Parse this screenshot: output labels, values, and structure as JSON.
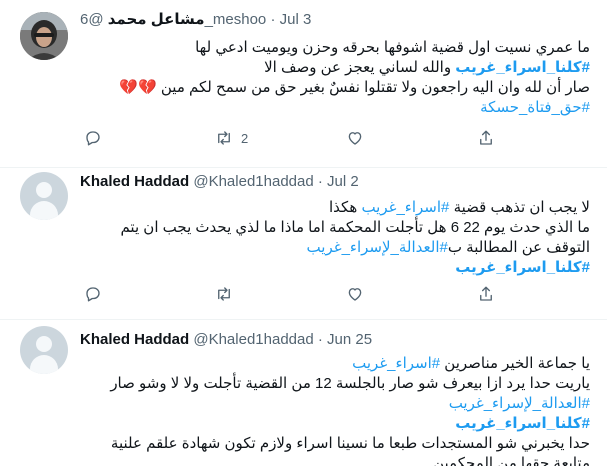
{
  "tweets": [
    {
      "name": "مشاعل محمد",
      "handle": "@6_meshoo",
      "separator": "·",
      "date": "Jul 3",
      "lines": [
        "ما عمري نسيت اول قضية اشوفها بحرقه وحزن ويوميت ادعي لها",
        "والله لساني يعجز عن وصف الا",
        "صار أن لله وان اليه راجعون ولا تقتلوا نفسٌ بغير حق من سمح لكم مين"
      ],
      "hashtag_main": "#كلنا_اسراء_غريب",
      "hashtag_small": "#حق_فتاة_حسكة",
      "hearts": "💔💔",
      "retweets": "2"
    },
    {
      "name": "Khaled Haddad",
      "handle": "@Khaled1haddad",
      "separator": "·",
      "date": "Jul 2",
      "line1_text": "لا يجب ان تذهب قضية",
      "line1_tag": "#اسراء_غريب",
      "line1_end": "هكذا",
      "line2": "ما الذي حدث يوم 22 6 هل تأجلت المحكمة اما ماذا ما لذي يحدث يجب ان يتم",
      "line3_text": "التوقف عن المطالبة ب",
      "line3_tag": "#العدالة_لإسراء_غريب",
      "hashtag_main": "#كلنا_اسراء_غريب"
    },
    {
      "name": "Khaled Haddad",
      "handle": "@Khaled1haddad",
      "separator": "·",
      "date": "Jun 25",
      "line1_text": "يا جماعة الخير مناصرين",
      "line1_tag": "#اسراء_غريب",
      "line2": "ياريت حدا يرد ازا بيعرف شو صار بالجلسة 12 من القضية تأجلت ولا لا وشو صار",
      "line3_tag": "#العدالة_لإسراء_غريب",
      "hashtag_main": "#كلنا_اسراء_غريب",
      "line5": "حدا يخبرني شو المستجدات طبعا ما نسينا اسراء ولازم تكون شهادة علقم علنية",
      "line6": "متابعة حقها من المحكمين"
    }
  ],
  "icons": {
    "reply": "reply-icon",
    "retweet": "retweet-icon",
    "like": "heart-icon",
    "share": "share-icon"
  },
  "colors": {
    "link": "#1d9bf0",
    "secondary_text": "#536471",
    "divider": "#eff3f4"
  }
}
